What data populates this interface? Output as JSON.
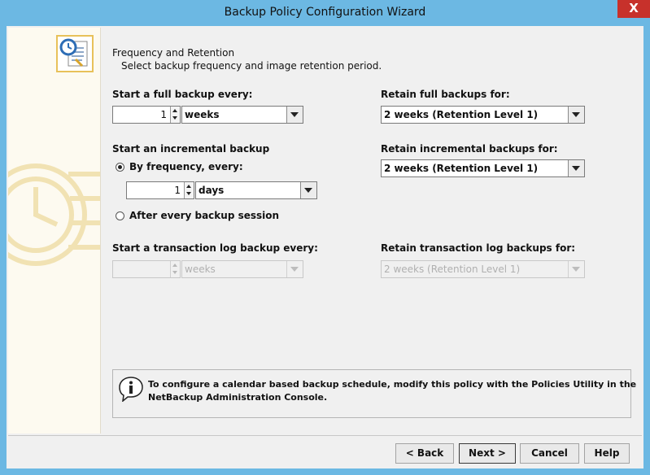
{
  "window": {
    "title": "Backup Policy Configuration Wizard",
    "close_glyph": "X"
  },
  "heading": {
    "title": "Frequency and Retention",
    "subtitle": "Select backup frequency and image retention period."
  },
  "full_backup": {
    "label": "Start a full backup every:",
    "value": "1",
    "unit": "weeks",
    "retain_label": "Retain full backups for:",
    "retain_value": "2 weeks (Retention Level 1)"
  },
  "incremental": {
    "label": "Start an incremental backup",
    "by_frequency_label": "By frequency, every:",
    "by_frequency_selected": true,
    "value": "1",
    "unit": "days",
    "after_session_label": "After every backup session",
    "after_session_selected": false,
    "retain_label": "Retain incremental backups for:",
    "retain_value": "2 weeks (Retention Level 1)"
  },
  "transaction_log": {
    "label": "Start a transaction log backup every:",
    "value": "",
    "unit": "weeks",
    "retain_label": "Retain transaction log backups for:",
    "retain_value": "2 weeks (Retention Level 1)",
    "enabled": false
  },
  "info": {
    "line1": "To configure a calendar based backup schedule, modify this policy with the Policies Utility in the",
    "line2": "NetBackup Administration Console."
  },
  "buttons": {
    "back": "< Back",
    "next": "Next >",
    "cancel": "Cancel",
    "help": "Help"
  },
  "icons": {
    "wizard": "clock-schedule-icon",
    "watermark": "clock-document-watermark-icon",
    "info": "info-balloon-icon",
    "spin_up": "arrow-up-icon",
    "spin_down": "arrow-down-icon",
    "dropdown": "chevron-down-icon"
  },
  "colors": {
    "title_bar": "#6cb8e3",
    "close_button": "#c7312b",
    "panel": "#f0f0f0",
    "sidebar": "#fdfaf0",
    "icon_accent": "#e8c15a"
  }
}
